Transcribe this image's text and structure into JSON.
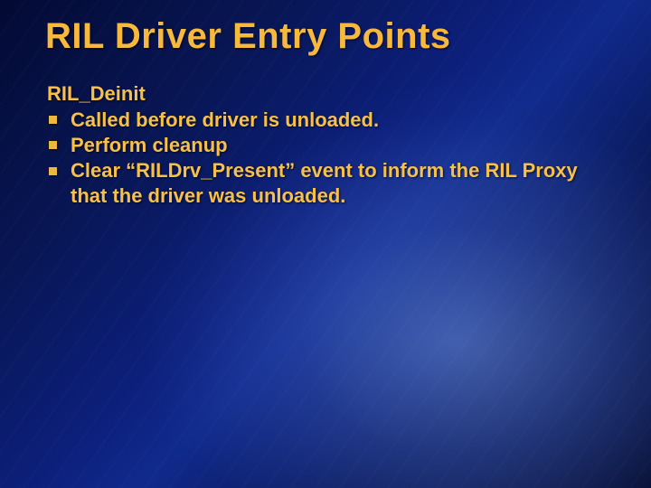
{
  "title": "RIL Driver Entry Points",
  "subheading": "RIL_Deinit",
  "bullets": [
    "Called before driver is unloaded.",
    "Perform cleanup",
    "Clear “RILDrv_Present” event to inform the RIL Proxy that the driver was unloaded."
  ]
}
